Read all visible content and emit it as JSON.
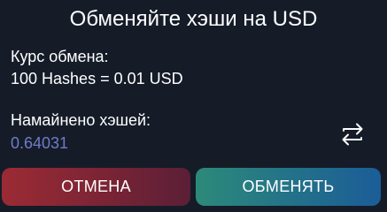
{
  "dialog": {
    "title": "Обменяйте хэши на USD",
    "rate_label": "Курс обмена:",
    "rate_value": "100 Hashes = 0.01 USD",
    "mined_label": "Намайнено хэшей:",
    "mined_value": "0.64031",
    "swap_icon": "swap-arrows-icon",
    "cancel_label": "ОТМЕНА",
    "confirm_label": "ОБМЕНЯТЬ"
  },
  "colors": {
    "background": "#151c28",
    "mined_value": "#6f7cc7",
    "cancel_gradient": [
      "#9b2b34",
      "#5b1f36"
    ],
    "confirm_gradient": [
      "#2c8a7a",
      "#1b5d97"
    ]
  }
}
